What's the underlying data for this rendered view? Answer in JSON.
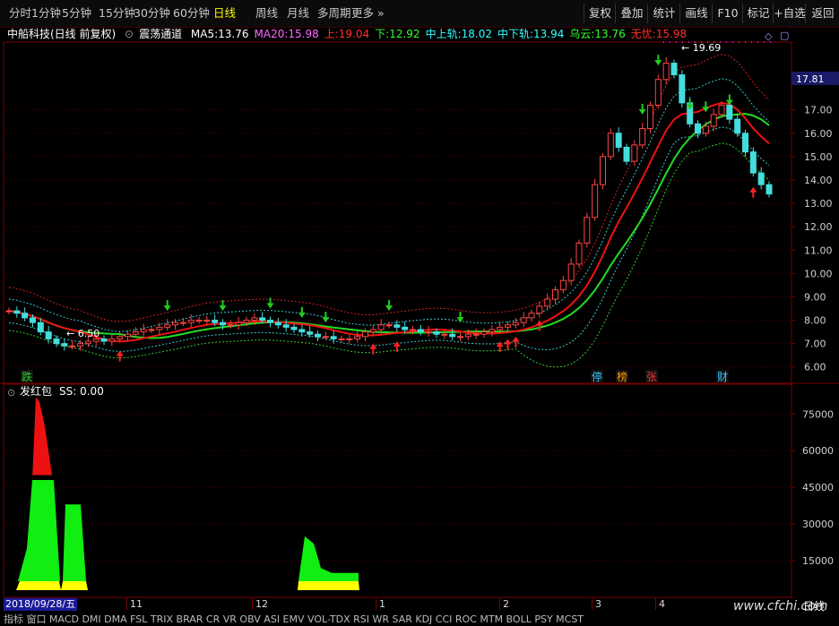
{
  "toolbar": {
    "periods": [
      "分时",
      "1分钟",
      "5分钟",
      "15分钟",
      "30分钟",
      "60分钟",
      "日线",
      "周线",
      "月线",
      "多周期",
      "更多"
    ],
    "active_period": "日线",
    "right_buttons": [
      "复权",
      "叠加",
      "统计",
      "画线",
      "F10",
      "标记",
      "+自选",
      "返回"
    ]
  },
  "main_header": {
    "stock": "中船科技(日线 前复权)",
    "indicator": "震荡通道",
    "items": [
      {
        "label": "MA5:",
        "value": "13.76",
        "color": "#ffffff"
      },
      {
        "label": "MA20:",
        "value": "15.98",
        "color": "#ff66ff"
      },
      {
        "label": "上:",
        "value": "19.04",
        "color": "#ff3030"
      },
      {
        "label": "下:",
        "value": "12.92",
        "color": "#33ff33"
      },
      {
        "label": "中上轨:",
        "value": "18.02",
        "color": "#33ffff"
      },
      {
        "label": "中下轨:",
        "value": "13.94",
        "color": "#33ffff"
      },
      {
        "label": "乌云:",
        "value": "13.76",
        "color": "#33ff33"
      },
      {
        "label": "无忧:",
        "value": "15.98",
        "color": "#ff3030"
      }
    ]
  },
  "sub_header": {
    "indicator": "发红包",
    "items": [
      {
        "label": "SS:",
        "value": "0.00"
      }
    ]
  },
  "price_axis": {
    "ticks": [
      "17.00",
      "16.00",
      "15.00",
      "14.00",
      "13.00",
      "12.00",
      "11.00",
      "10.00",
      "9.00",
      "8.00",
      "7.00",
      "6.00"
    ],
    "current_tag": "17.81"
  },
  "volume_axis": {
    "ticks": [
      "75000",
      "60000",
      "45000",
      "30000",
      "15000"
    ]
  },
  "annotations": {
    "high": "19.69",
    "low": "6.50"
  },
  "event_tags": [
    {
      "text": "跌",
      "color": "#33cc33"
    },
    {
      "text": "停",
      "color": "#33ccff"
    },
    {
      "text": "榜",
      "color": "#ff9900"
    },
    {
      "text": "张",
      "color": "#ff3030"
    },
    {
      "text": "财",
      "color": "#33ccff"
    }
  ],
  "date_axis": {
    "first": "2018/09/28/五",
    "months": [
      "11",
      "12",
      "1",
      "2",
      "3",
      "4"
    ],
    "period": "日线"
  },
  "bottom_tabs": "指标 窗口 MACD DMI DMA FSL TRIX BRAR CR VR OBV ASI EMV VOL-TDX RSI WR SAR KDJ CCI ROC MTM BOLL PSY MCST",
  "watermark": "www.cfchi.com",
  "chart_data": {
    "type": "line",
    "title": "中船科技(日线 前复权)",
    "ylim": [
      5.0,
      20.0
    ],
    "price_series_note": "日K线 收盘价估计 (daily close, estimated)",
    "close": [
      8.4,
      8.3,
      8.1,
      7.9,
      7.5,
      7.2,
      7.0,
      6.9,
      6.9,
      7.0,
      7.1,
      7.2,
      7.1,
      7.2,
      7.3,
      7.4,
      7.5,
      7.6,
      7.6,
      7.7,
      7.8,
      7.9,
      7.9,
      8.0,
      8.0,
      8.0,
      7.9,
      7.8,
      7.8,
      7.9,
      8.0,
      8.1,
      8.0,
      7.9,
      7.8,
      7.7,
      7.6,
      7.5,
      7.4,
      7.3,
      7.3,
      7.2,
      7.2,
      7.2,
      7.3,
      7.5,
      7.6,
      7.8,
      7.8,
      7.7,
      7.6,
      7.6,
      7.5,
      7.5,
      7.4,
      7.4,
      7.3,
      7.3,
      7.4,
      7.4,
      7.5,
      7.6,
      7.7,
      7.8,
      7.9,
      8.1,
      8.3,
      8.6,
      8.9,
      9.3,
      9.7,
      10.4,
      11.3,
      12.4,
      13.8,
      15.0,
      16.0,
      15.4,
      14.8,
      15.5,
      16.2,
      17.2,
      18.3,
      19.0,
      18.5,
      17.3,
      16.4,
      16.0,
      16.3,
      16.8,
      17.2,
      16.6,
      16.0,
      15.2,
      14.3,
      13.8,
      13.4
    ],
    "ma20_note": "红色均线 (MA20, estimated)",
    "volume_note": "发红包 柱状面积 (estimated)",
    "volume_peaks": [
      {
        "segment": "2018-10",
        "value": 82000
      },
      {
        "segment": "2018-11",
        "value": 38000
      },
      {
        "segment": "2019-01",
        "value": 25000
      }
    ],
    "volume_ylim": [
      0,
      85000
    ]
  }
}
